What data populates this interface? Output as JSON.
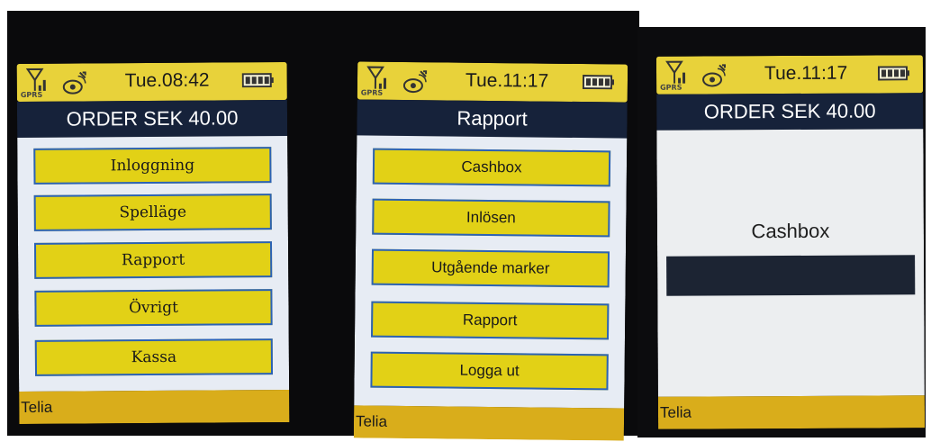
{
  "screens": [
    {
      "status": {
        "time": "Tue.08:42",
        "network": "GPRS"
      },
      "title": "ORDER SEK 40.00",
      "menu": [
        {
          "label": "Inloggning"
        },
        {
          "label": "Spelläge"
        },
        {
          "label": "Rapport"
        },
        {
          "label": "Övrigt"
        },
        {
          "label": "Kassa"
        }
      ],
      "footer": "Telia"
    },
    {
      "status": {
        "time": "Tue.11:17",
        "network": "GPRS"
      },
      "title": "Rapport",
      "menu": [
        {
          "label": "Cashbox"
        },
        {
          "label": "Inlösen"
        },
        {
          "label": "Utgående marker"
        },
        {
          "label": "Rapport"
        },
        {
          "label": "Logga ut"
        }
      ],
      "footer": "Telia"
    },
    {
      "status": {
        "time": "Tue.11:17",
        "network": "GPRS"
      },
      "title": "ORDER SEK 40.00",
      "prompt": "Cashbox",
      "footer": "Telia"
    }
  ],
  "icons": {
    "signal": "signal-icon",
    "gps": "gps-satellite-icon",
    "battery": "battery-icon"
  },
  "colors": {
    "status_bar": "#e8d23a",
    "title_bar": "#16223a",
    "button": "#e2d116",
    "button_border": "#2b62b6",
    "footer": "#d9ad1b",
    "content_bg": "#e7ecf4"
  }
}
